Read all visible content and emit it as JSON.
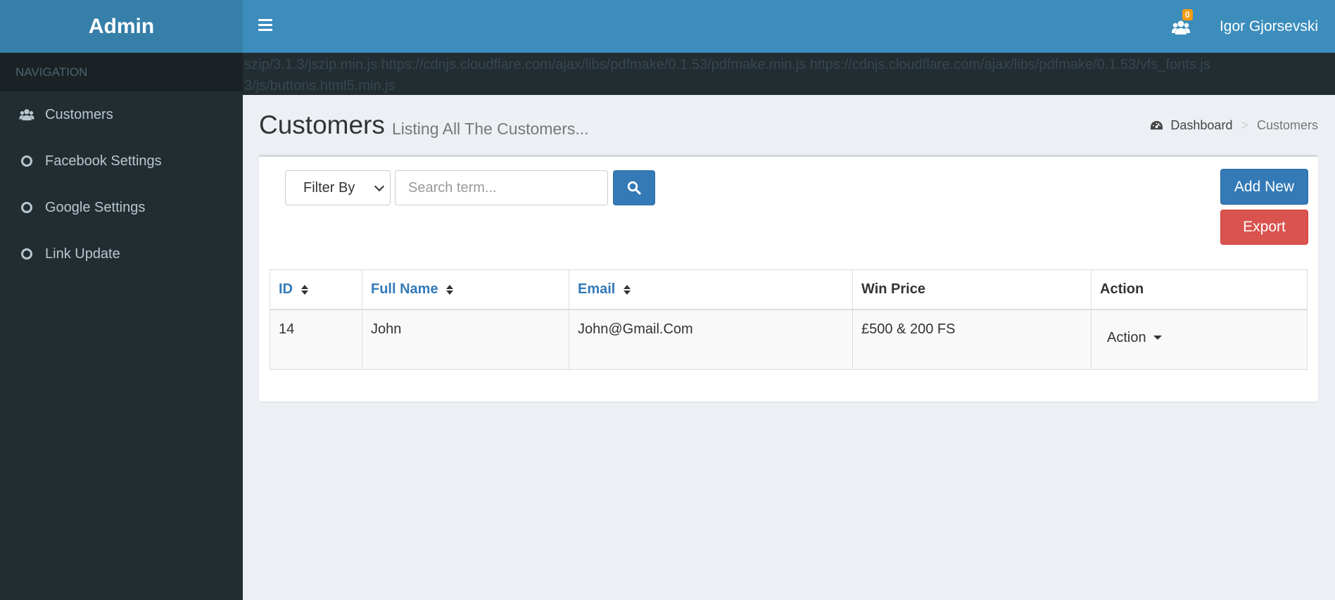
{
  "header": {
    "logo": "Admin",
    "notification_count": "0",
    "user_name": "Igor Gjorsevski"
  },
  "sidebar": {
    "nav_header": "NAVIGATION",
    "items": [
      {
        "label": "Customers",
        "icon": "users-icon"
      },
      {
        "label": "Facebook Settings",
        "icon": "circle-o-icon"
      },
      {
        "label": "Google Settings",
        "icon": "circle-o-icon"
      },
      {
        "label": "Link Update",
        "icon": "circle-o-icon"
      }
    ]
  },
  "debug": {
    "line1": "szip/3.1.3/jszip.min.js https://cdnjs.cloudflare.com/ajax/libs/pdfmake/0.1.53/pdfmake.min.js https://cdnjs.cloudflare.com/ajax/libs/pdfmake/0.1.53/vfs_fonts.js",
    "line2": "3/js/buttons.html5.min.js"
  },
  "page": {
    "title": "Customers",
    "subtitle": "Listing All The Customers..."
  },
  "breadcrumb": {
    "home": "Dashboard",
    "separator": ">",
    "current": "Customers"
  },
  "toolbar": {
    "filter_label": "Filter By",
    "search_placeholder": "Search term...",
    "add_label": "Add New",
    "export_label": "Export"
  },
  "table": {
    "columns": [
      "ID",
      "Full Name",
      "Email",
      "Win Price",
      "Action"
    ],
    "rows": [
      {
        "id": "14",
        "full_name": "John",
        "email": "John@Gmail.Com",
        "win_price": "£500 & 200 FS",
        "action": "Action"
      }
    ]
  },
  "colors": {
    "header": "#3c8dbc",
    "logo_bg": "#367fa9",
    "sidebar": "#222d32",
    "primary": "#337ab7",
    "danger": "#d9534f",
    "badge": "#f39c12"
  }
}
